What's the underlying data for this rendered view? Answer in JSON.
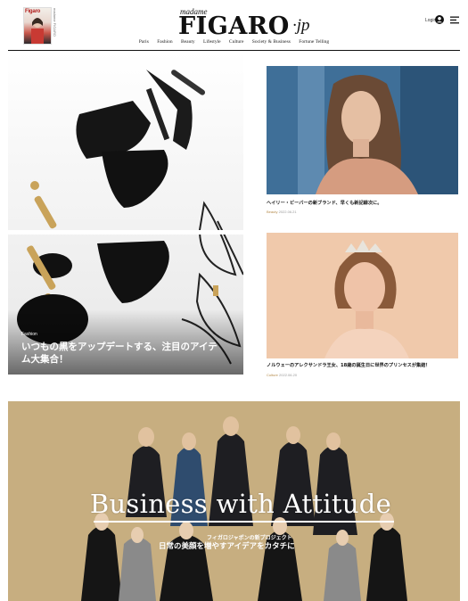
{
  "header": {
    "magazine_thumb_title": "Figaro",
    "magazine_thumb_side": "madame FIGARO",
    "logo_small": "madame",
    "logo_main": "FIGARO",
    "logo_suffix": "·jp",
    "login_label": "Login"
  },
  "nav": {
    "items": [
      "Paris",
      "Fashion",
      "Beauty",
      "Lifestyle",
      "Culture",
      "Society & Business",
      "Fortune Telling"
    ]
  },
  "feature": {
    "category": "Fashion",
    "title_line1": "いつもの黒をアップデートする、注目のアイテ",
    "title_line2": "ム大集合！"
  },
  "articles": [
    {
      "title": "ヘイリー・ビーバーの新ブランド、早くも新記録次に。",
      "category": "Beauty",
      "date": "2022.06.21"
    },
    {
      "title": "ノルウェーのアレクサンドラ王女、18歳の誕生日に世界のプリンセスが集結！",
      "category": "Culture",
      "date": "2022.06.20"
    }
  ],
  "banner": {
    "title": "Business with Attitude",
    "subtitle": "フィガロジャポンの新プロジェクト",
    "copy": "日常の美顔を増やすアイデアをカタチに"
  },
  "colors": {
    "banner_bg": "#c7ae80",
    "category_accent": "#b58b4c",
    "text": "#111111"
  },
  "icons": [
    "user-icon",
    "menu-icon"
  ]
}
